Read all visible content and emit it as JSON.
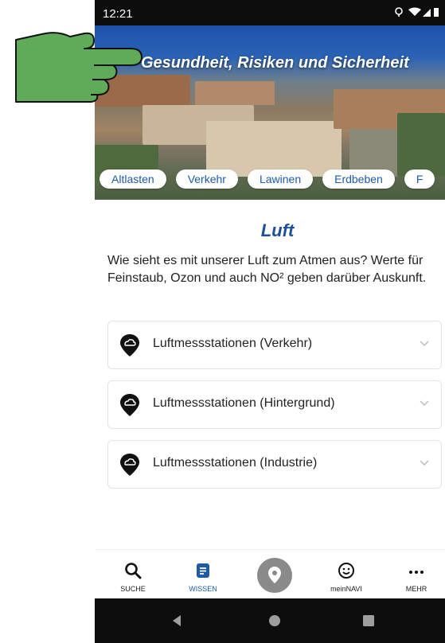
{
  "status_bar": {
    "time": "12:21"
  },
  "hero": {
    "title": "Gesundheit, Risiken und Sicherheit"
  },
  "chips": [
    "Altlasten",
    "Verkehr",
    "Lawinen",
    "Erdbeben",
    "F"
  ],
  "section": {
    "title": "Luft",
    "intro": "Wie sieht es mit unserer Luft zum Atmen aus? Werte für Feinstaub, Ozon und auch NO² geben darüber Auskunft."
  },
  "accordions": [
    {
      "label": "Luftmessstationen (Verkehr)",
      "icon": "cloud-pin-icon"
    },
    {
      "label": "Luftmessstationen (Hintergrund)",
      "icon": "cloud-pin-icon"
    },
    {
      "label": "Luftmessstationen (Industrie)",
      "icon": "cloud-pin-icon"
    }
  ],
  "bottom_nav": {
    "items": [
      {
        "label": "SUCHE",
        "icon": "search-icon",
        "active": false
      },
      {
        "label": "WISSEN",
        "icon": "document-icon",
        "active": true
      },
      {
        "label": "meinNAVI",
        "icon": "smiley-icon",
        "active": false
      },
      {
        "label": "MEHR",
        "icon": "more-icon",
        "active": false
      }
    ],
    "center_icon": "location-pin-icon"
  },
  "colors": {
    "accent": "#1f5aa6",
    "title_blue": "#1f4f9c",
    "hand_green": "#5fab5a"
  }
}
